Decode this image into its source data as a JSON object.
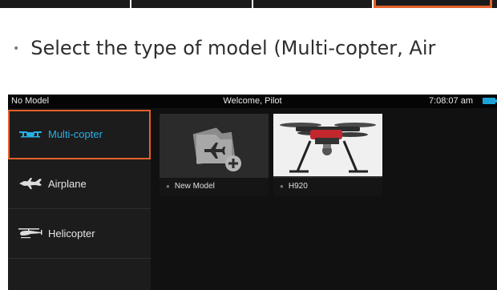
{
  "instruction": {
    "bullet": "•",
    "text": "Select the type of model (Multi-copter, Air"
  },
  "status_bar": {
    "left": "No Model",
    "center": "Welcome, Pilot",
    "time": "7:08:07 am",
    "battery_icon": "battery-icon"
  },
  "sidebar": {
    "items": [
      {
        "label": "Multi-copter",
        "icon": "multicopter-icon",
        "selected": true
      },
      {
        "label": "Airplane",
        "icon": "airplane-icon",
        "selected": false
      },
      {
        "label": "Helicopter",
        "icon": "helicopter-icon",
        "selected": false
      }
    ]
  },
  "models": [
    {
      "label": "New Model",
      "icon": "new-model-icon"
    },
    {
      "label": "H920",
      "icon": "h920-drone-photo"
    }
  ],
  "colors": {
    "highlight": "#e4612c",
    "selected_text": "#27b0e6",
    "battery": "#1ea3d8"
  }
}
